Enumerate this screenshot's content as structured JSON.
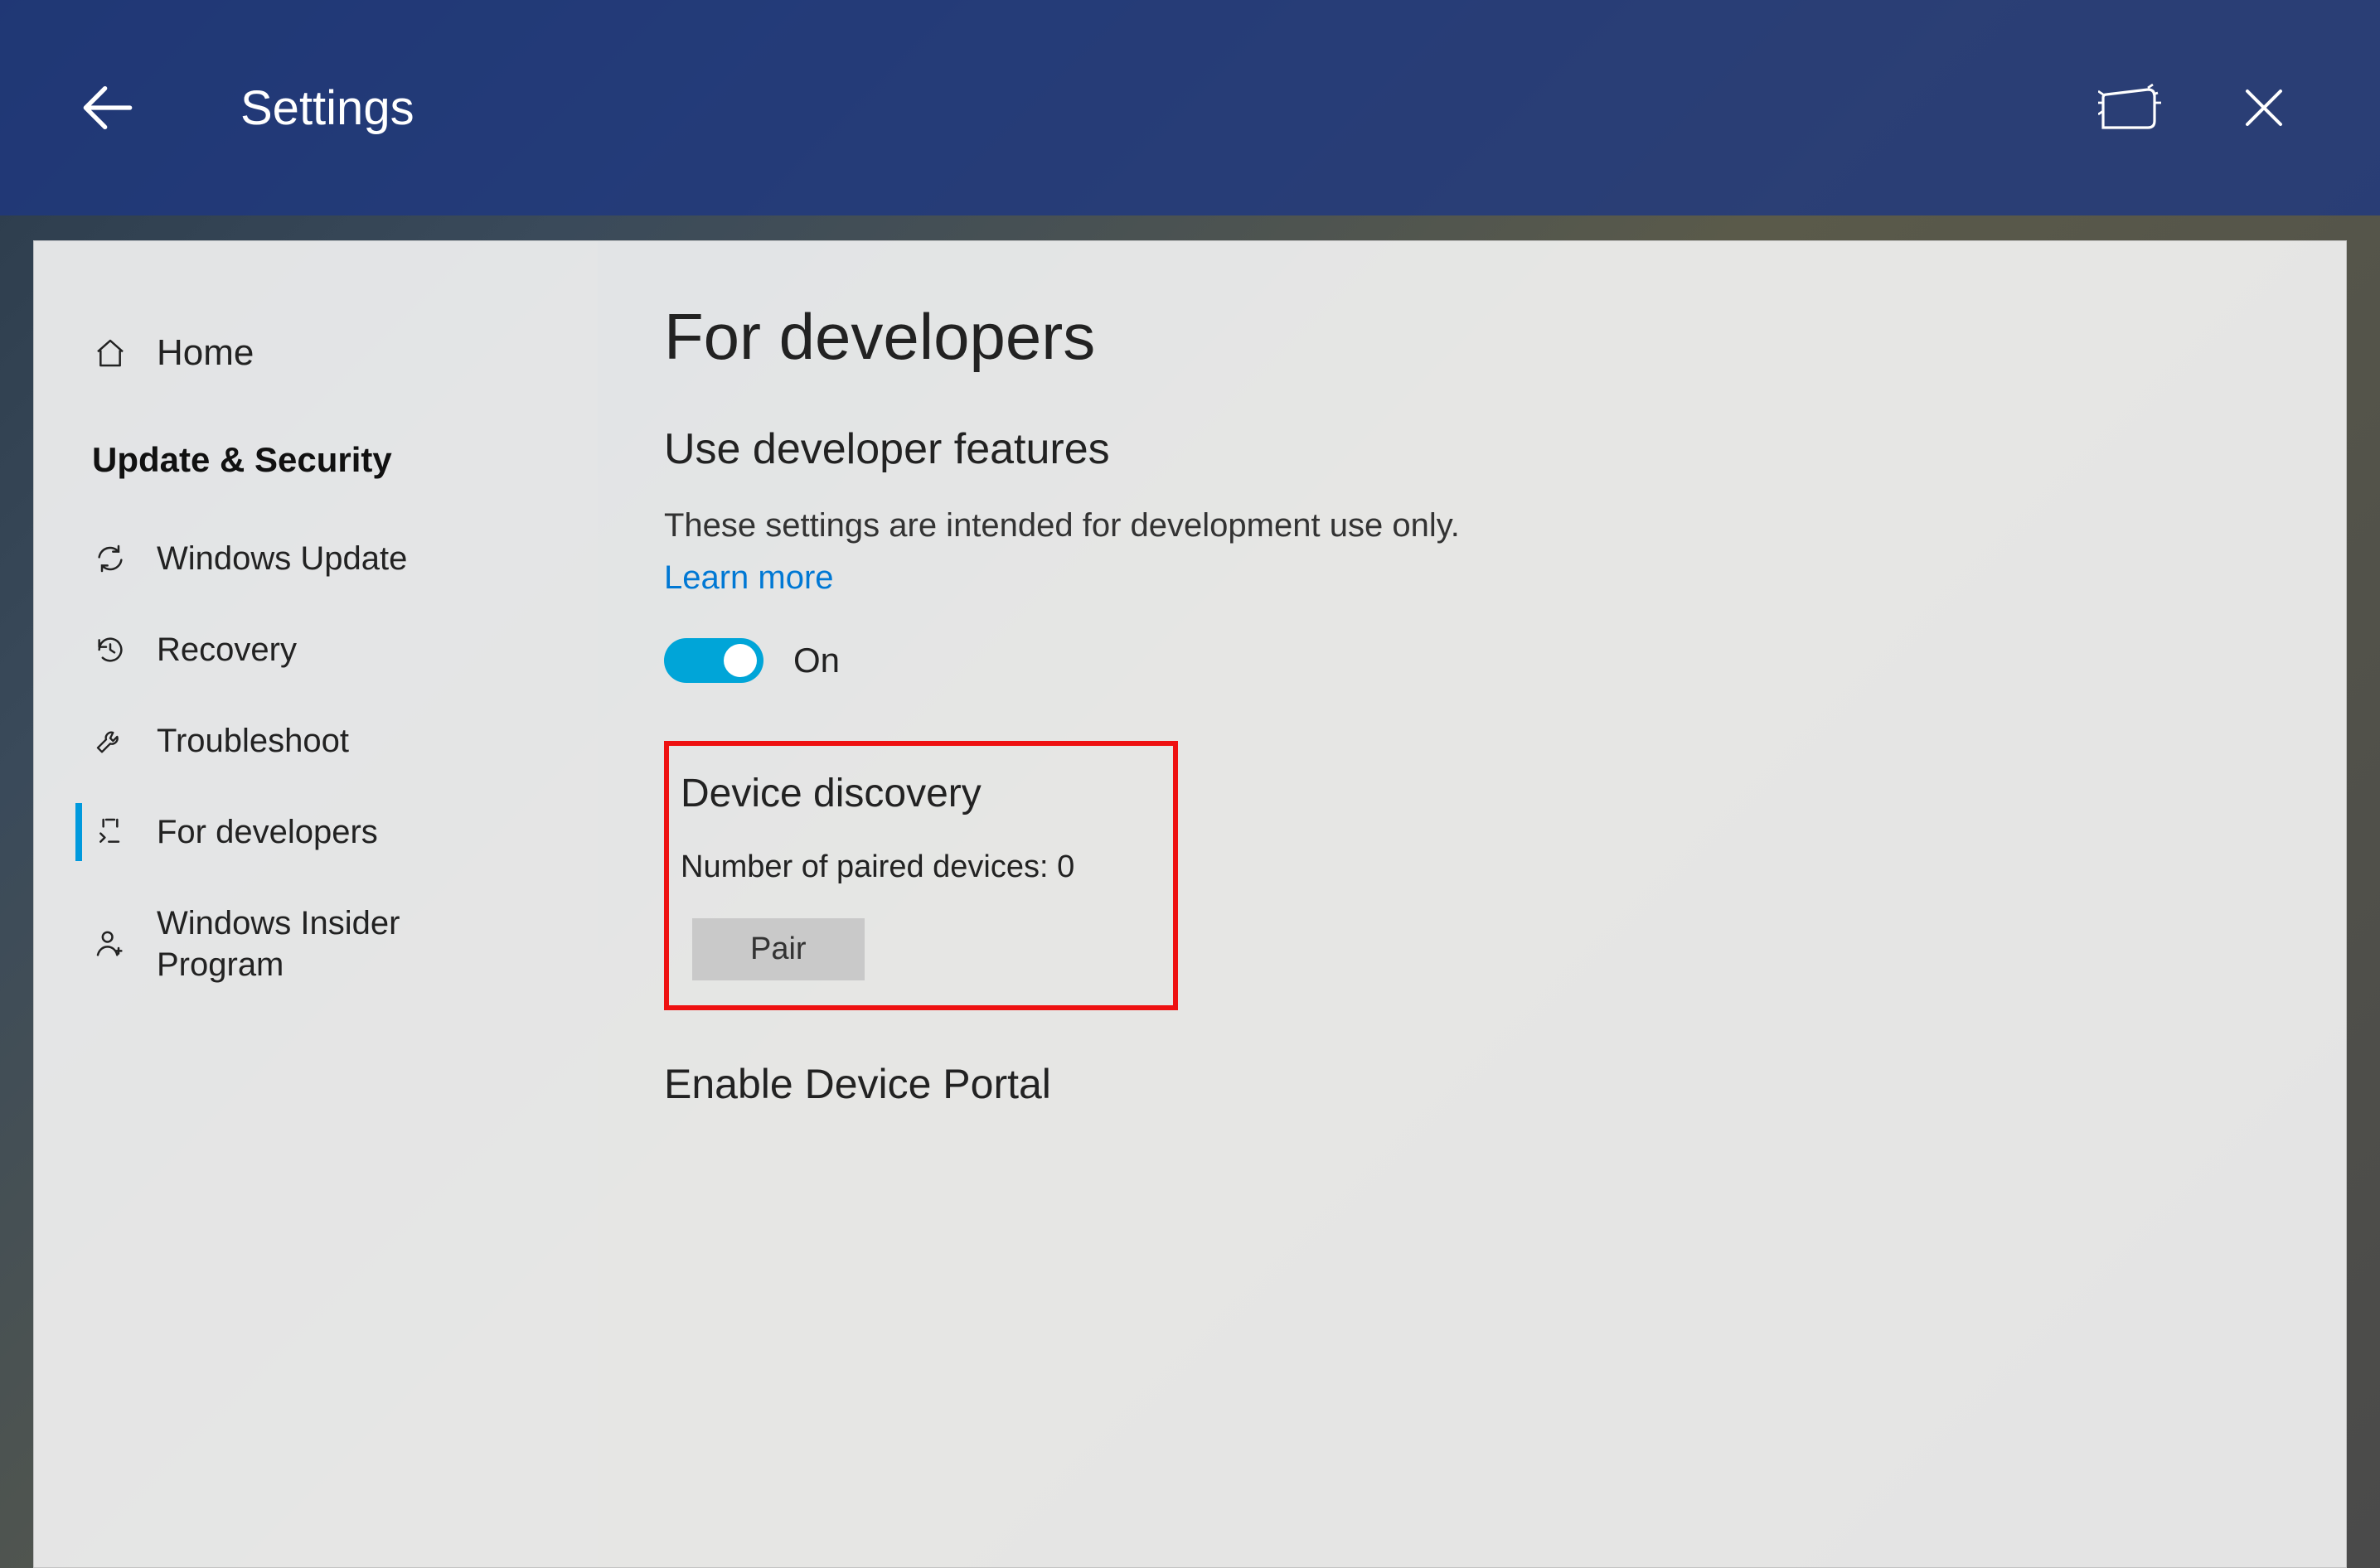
{
  "titlebar": {
    "title": "Settings"
  },
  "sidebar": {
    "home": "Home",
    "section": "Update & Security",
    "items": [
      {
        "icon": "sync-icon",
        "label": "Windows Update"
      },
      {
        "icon": "history-icon",
        "label": "Recovery"
      },
      {
        "icon": "wrench-icon",
        "label": "Troubleshoot"
      },
      {
        "icon": "devtools-icon",
        "label": "For developers",
        "active": true
      },
      {
        "icon": "person-icon",
        "label": "Windows Insider Program"
      }
    ]
  },
  "content": {
    "page_title": "For developers",
    "use_dev_features_title": "Use developer features",
    "use_dev_features_desc": "These settings are intended for development use only.",
    "learn_more": "Learn more",
    "toggle": {
      "state": "on",
      "label": "On"
    },
    "device_discovery": {
      "title": "Device discovery",
      "paired_label": "Number of paired devices:",
      "paired_count": 0,
      "pair_button": "Pair"
    },
    "enable_portal_title": "Enable Device Portal"
  },
  "colors": {
    "accent": "#00a5d8",
    "link": "#0078d4",
    "highlight": "#e11"
  }
}
